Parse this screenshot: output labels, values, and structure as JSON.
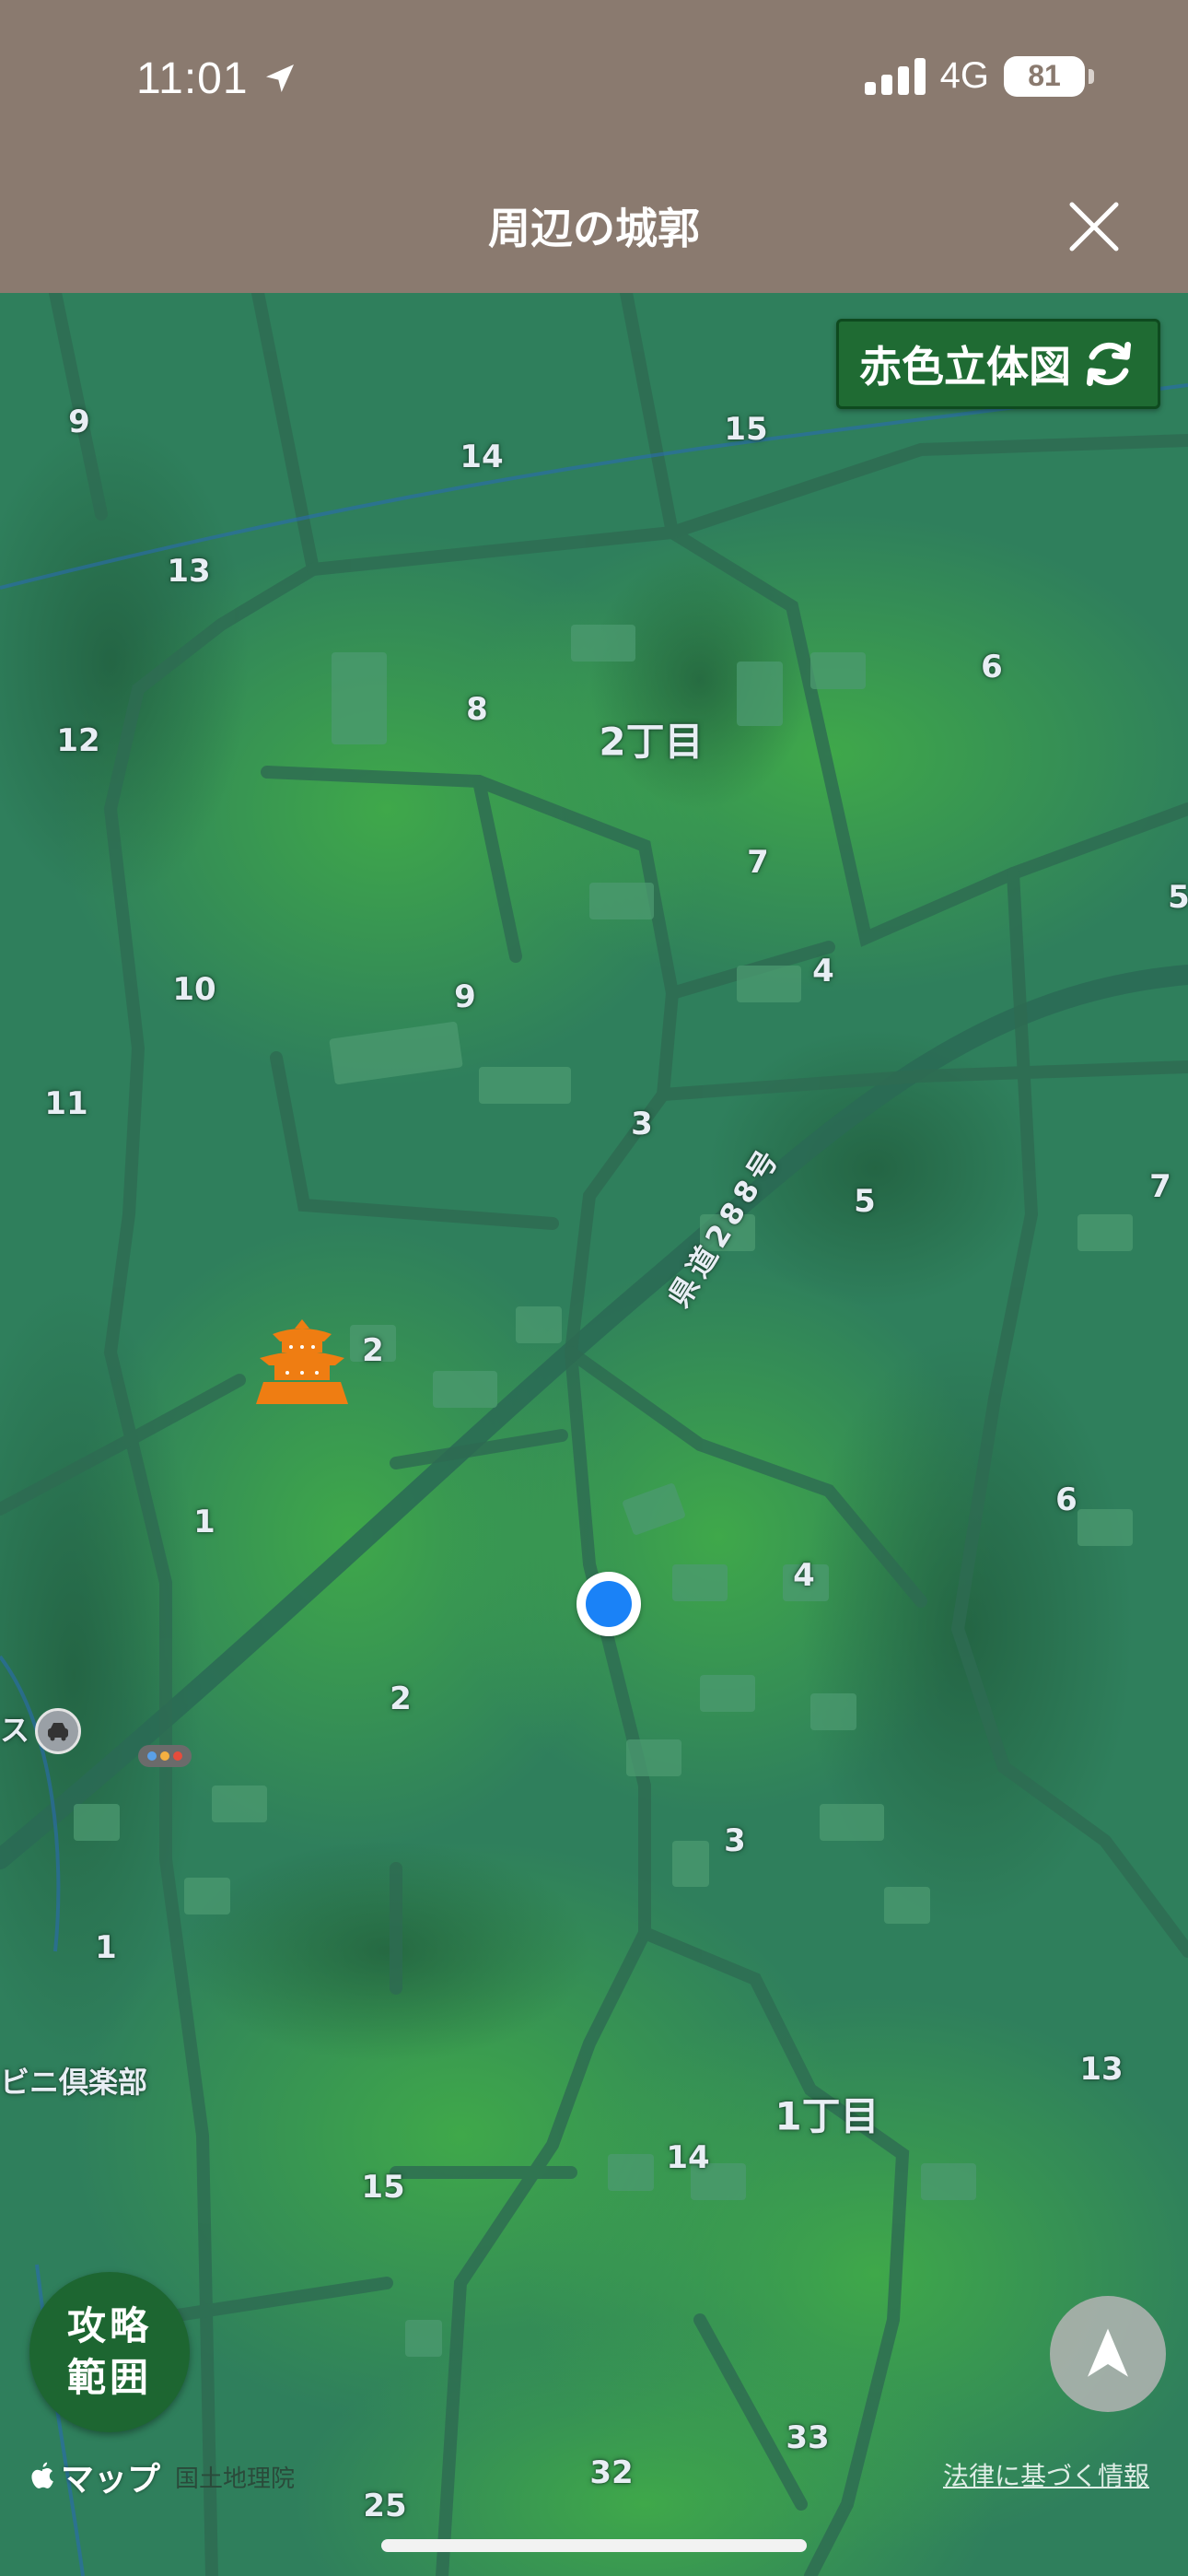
{
  "status_bar": {
    "time": "11:01",
    "network": "4G",
    "battery": "81"
  },
  "header": {
    "title": "周辺の城郭"
  },
  "map": {
    "relief_toggle_label": "赤色立体図",
    "capture_range_label_line1": "攻略",
    "capture_range_label_line2": "範囲",
    "attribution_maps": "マップ",
    "attribution_gsi": "国土地理院",
    "legal_link": "法律に基づく情報",
    "area_labels": [
      "2丁目",
      "1丁目"
    ],
    "road_label": "県道288号",
    "block_numbers": [
      "9",
      "14",
      "15",
      "13",
      "6",
      "12",
      "8",
      "7",
      "5",
      "10",
      "9",
      "4",
      "11",
      "3",
      "5",
      "7",
      "2",
      "6",
      "1",
      "4",
      "2",
      "3",
      "1",
      "13",
      "15",
      "14",
      "33",
      "32",
      "25"
    ],
    "poi_partial_labels": [
      "ス",
      "ビニ倶楽部"
    ]
  }
}
